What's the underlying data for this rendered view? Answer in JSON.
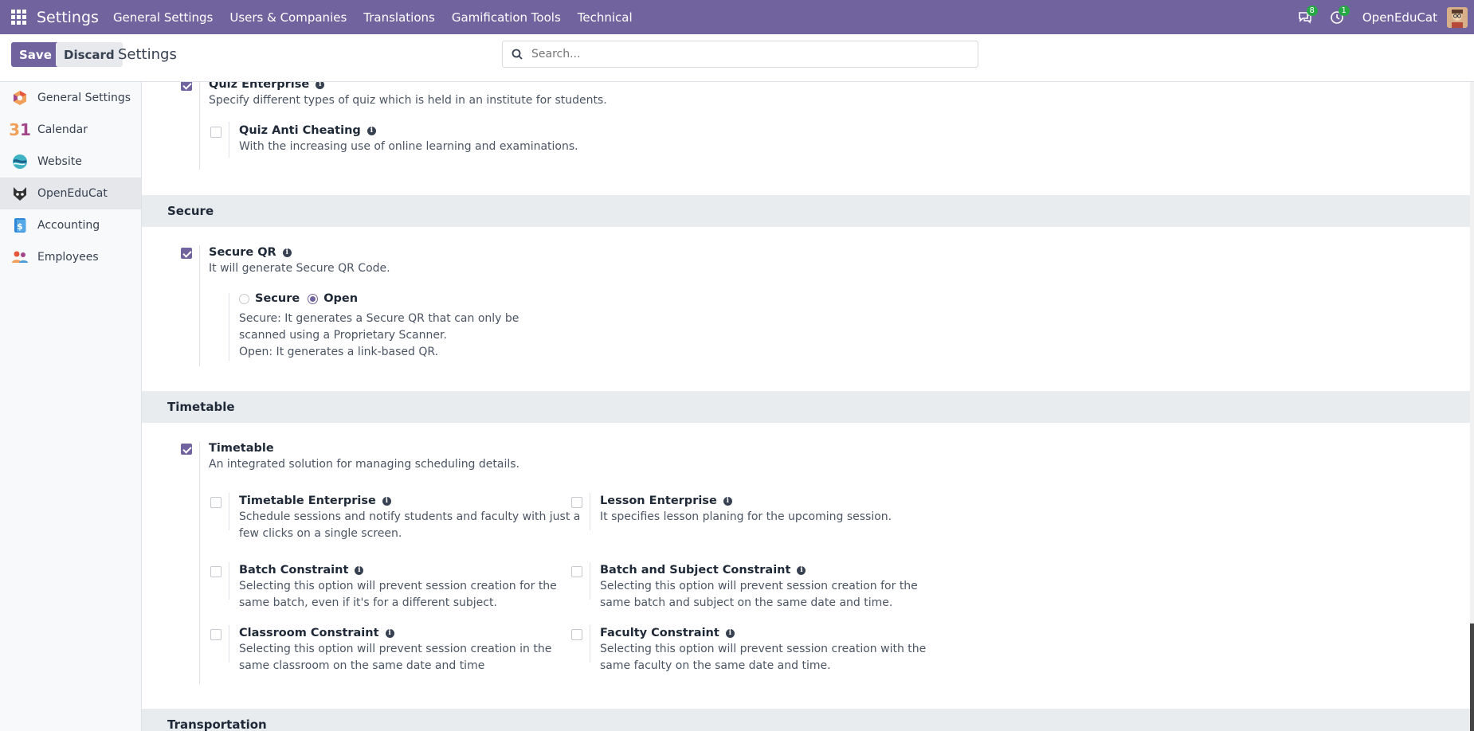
{
  "topnav": {
    "brand": "Settings",
    "menu": [
      "General Settings",
      "Users & Companies",
      "Translations",
      "Gamification Tools",
      "Technical"
    ],
    "messages_badge": "8",
    "activity_badge": "1",
    "user": "OpenEduCat"
  },
  "control": {
    "save": "Save",
    "discard": "Discard",
    "breadcrumb": "Settings",
    "search_placeholder": "Search..."
  },
  "sidebar": {
    "items": [
      {
        "label": "General Settings",
        "icon": "odoo-logo-icon"
      },
      {
        "label": "Calendar",
        "icon": "calendar-icon",
        "glyph": "31"
      },
      {
        "label": "Website",
        "icon": "website-icon"
      },
      {
        "label": "OpenEduCat",
        "icon": "openeducat-icon",
        "active": true
      },
      {
        "label": "Accounting",
        "icon": "accounting-icon",
        "glyph": "$"
      },
      {
        "label": "Employees",
        "icon": "employees-icon"
      }
    ]
  },
  "quiz": {
    "enterprise_title": "Quiz Enterprise",
    "enterprise_desc": "Specify different types of quiz which is held in an institute for students.",
    "anti_title": "Quiz Anti Cheating",
    "anti_desc": "With the increasing use of online learning and examinations."
  },
  "secure": {
    "heading": "Secure",
    "title": "Secure QR",
    "desc": "It will generate Secure QR Code.",
    "radio_secure": "Secure",
    "radio_open": "Open",
    "selected": "Open",
    "help1": "Secure: It generates a Secure QR that can only be",
    "help2": "scanned using a Proprietary Scanner.",
    "help3": "Open: It generates a link-based QR."
  },
  "timetable": {
    "heading": "Timetable",
    "title": "Timetable",
    "desc": "An integrated solution for managing scheduling details.",
    "options": [
      {
        "title": "Timetable Enterprise",
        "desc1": "Schedule sessions and notify students and faculty with just a",
        "desc2": "few clicks on a single screen."
      },
      {
        "title": "Lesson Enterprise",
        "desc1": "It specifies lesson planing for the upcoming session.",
        "desc2": ""
      },
      {
        "title": "Batch Constraint",
        "desc1": "Selecting this option will prevent session creation for the",
        "desc2": "same batch, even if it's for a different subject."
      },
      {
        "title": "Batch and Subject Constraint",
        "desc1": "Selecting this option will prevent session creation for the",
        "desc2": "same batch and subject on the same date and time."
      },
      {
        "title": "Classroom Constraint",
        "desc1": "Selecting this option will prevent session creation in the",
        "desc2": "same classroom on the same date and time"
      },
      {
        "title": "Faculty Constraint",
        "desc1": "Selecting this option will prevent session creation with the",
        "desc2": "same faculty on the same date and time."
      }
    ]
  },
  "transportation": {
    "heading": "Transportation"
  }
}
